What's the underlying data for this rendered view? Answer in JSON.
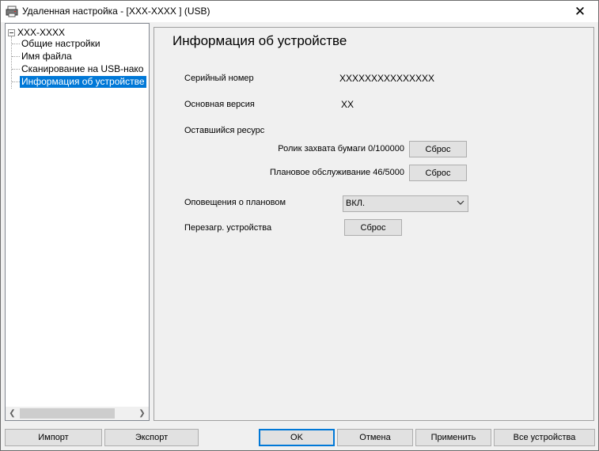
{
  "window": {
    "title": "Удаленная настройка - [XXX-XXXX ] (USB)",
    "close_glyph": "✕"
  },
  "tree": {
    "root": "XXX-XXXX",
    "items": [
      {
        "label": "Общие настройки"
      },
      {
        "label": "Имя файла"
      },
      {
        "label": "Сканирование на USB-нако"
      },
      {
        "label": "Информация об устройстве",
        "selected": true
      }
    ]
  },
  "panel": {
    "title": "Информация об устройстве",
    "serial_label": "Серийный номер",
    "serial_value": "XXXXXXXXXXXXXXX",
    "version_label": "Основная версия",
    "version_value": "XX",
    "remaining_label": "Оставшийся ресурс",
    "roller_label": "Ролик захвата бумаги 0/100000",
    "roller_reset": "Сброс",
    "maintenance_label": "Плановое обслуживание 46/5000",
    "maintenance_reset": "Сброс",
    "notify_label": "Оповещения о плановом",
    "notify_value": "ВКЛ.",
    "reboot_label": "Перезагр. устройства",
    "reboot_button": "Сброс"
  },
  "footer": {
    "import": "Импорт",
    "export": "Экспорт",
    "ok": "OK",
    "cancel": "Отмена",
    "apply": "Применить",
    "all_devices": "Все устройства"
  },
  "colors": {
    "selection": "#0078d7",
    "window_bg": "#f0f0f0",
    "button_bg": "#e1e1e1"
  }
}
